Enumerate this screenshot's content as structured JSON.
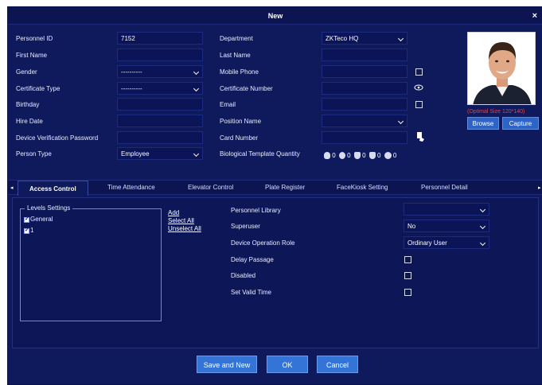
{
  "window": {
    "title": "New",
    "close_label": "×"
  },
  "form": {
    "personnel_id": {
      "label": "Personnel ID",
      "value": "7152"
    },
    "first_name": {
      "label": "First Name",
      "value": ""
    },
    "gender": {
      "label": "Gender",
      "value": "----------"
    },
    "certificate_type": {
      "label": "Certificate Type",
      "value": "----------"
    },
    "birthday": {
      "label": "Birthday",
      "value": ""
    },
    "hire_date": {
      "label": "Hire Date",
      "value": ""
    },
    "device_verification_password": {
      "label": "Device Verification Password",
      "value": ""
    },
    "person_type": {
      "label": "Person Type",
      "value": "Employee"
    },
    "department": {
      "label": "Department",
      "value": "ZKTeco HQ"
    },
    "last_name": {
      "label": "Last Name",
      "value": ""
    },
    "mobile_phone": {
      "label": "Mobile Phone",
      "value": ""
    },
    "certificate_number": {
      "label": "Certificate Number",
      "value": ""
    },
    "email": {
      "label": "Email",
      "value": ""
    },
    "position_name": {
      "label": "Position Name",
      "value": ""
    },
    "card_number": {
      "label": "Card Number",
      "value": ""
    },
    "biological_template_quantity": {
      "label": "Biological Template Quantity",
      "counts": [
        "0",
        "0",
        "0",
        "0",
        "0"
      ]
    }
  },
  "photo": {
    "optimal_size": "(Optimal Size 120*140)",
    "browse_label": "Browse",
    "capture_label": "Capture"
  },
  "tabs": [
    "Access Control",
    "Time Attendance",
    "Elevator Control",
    "Plate Register",
    "FaceKiosk Setting",
    "Personnel Detail"
  ],
  "access": {
    "levels_title": "Levels Settings",
    "levels": [
      "General",
      "1"
    ],
    "add_label": "Add",
    "select_all_label": "Select All",
    "unselect_all_label": "Unselect All",
    "personnel_library": {
      "label": "Personnel Library",
      "value": ""
    },
    "superuser": {
      "label": "Superuser",
      "value": "No"
    },
    "device_operation_role": {
      "label": "Device Operation Role",
      "value": "Ordinary User"
    },
    "delay_passage": {
      "label": "Delay Passage"
    },
    "disabled": {
      "label": "Disabled"
    },
    "set_valid_time": {
      "label": "Set Valid Time"
    }
  },
  "footer": {
    "save_and_new": "Save and New",
    "ok": "OK",
    "cancel": "Cancel"
  },
  "colors": {
    "background": "#0f1a5c",
    "button": "#3374d6",
    "accent_red": "#e8433b"
  },
  "icons": [
    "fingerprint-icon",
    "finger-vein-icon",
    "palm-icon",
    "palm-vein-icon",
    "face-icon",
    "eye-icon",
    "read-card-icon"
  ]
}
